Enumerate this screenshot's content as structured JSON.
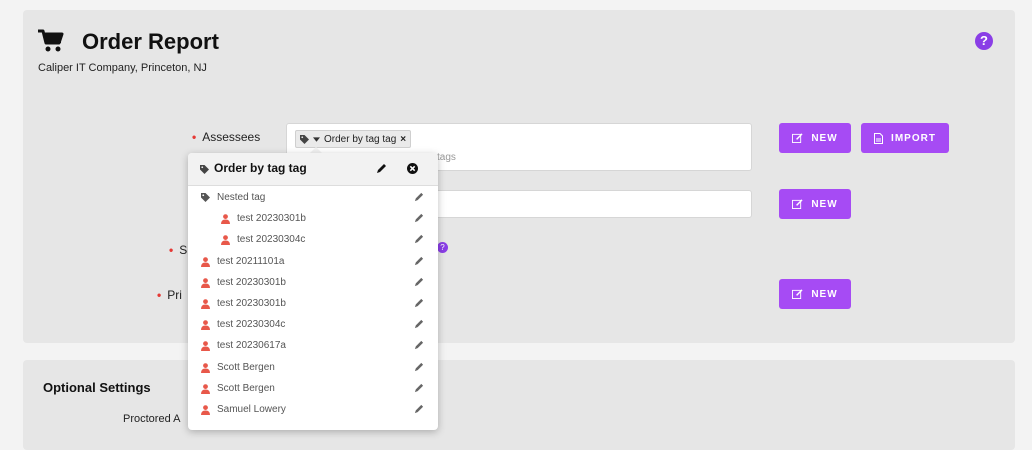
{
  "header": {
    "title": "Order Report",
    "subtitle": "Caliper IT Company, Princeton, NJ",
    "help_icon": "?"
  },
  "form": {
    "assessees_label": "Assessees",
    "assessees_tag": "Order by tag tag",
    "assessees_tag_remove": "×",
    "assessees_placeholder_tail": "tags",
    "label_s": "S",
    "label_pri": "Pri",
    "small_help": "?"
  },
  "buttons": {
    "new": "NEW",
    "import": "IMPORT"
  },
  "popover": {
    "title": "Order by tag tag",
    "items": [
      {
        "label": "Nested tag",
        "kind": "tag",
        "indent": false
      },
      {
        "label": "test 20230301b",
        "kind": "person",
        "indent": true
      },
      {
        "label": "test 20230304c",
        "kind": "person",
        "indent": true
      },
      {
        "label": "test 20211101a",
        "kind": "person",
        "indent": false
      },
      {
        "label": "test 20230301b",
        "kind": "person",
        "indent": false
      },
      {
        "label": "test 20230301b",
        "kind": "person",
        "indent": false
      },
      {
        "label": "test 20230304c",
        "kind": "person",
        "indent": false
      },
      {
        "label": "test 20230617a",
        "kind": "person",
        "indent": false
      },
      {
        "label": "Scott Bergen",
        "kind": "person",
        "indent": false
      },
      {
        "label": "Scott Bergen",
        "kind": "person",
        "indent": false
      },
      {
        "label": "Samuel Lowery",
        "kind": "person",
        "indent": false
      }
    ]
  },
  "optional": {
    "title": "Optional Settings",
    "proctored_label": "Proctored A"
  },
  "colors": {
    "accent": "#a64bf4",
    "required": "#e53935",
    "person_icon": "#e8584a"
  }
}
